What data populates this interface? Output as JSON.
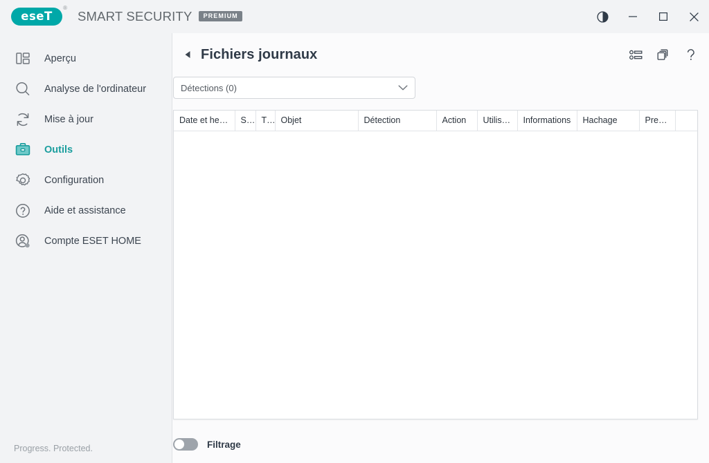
{
  "window": {
    "brand_logo_text": "eseT",
    "brand_registered_mark": "®",
    "brand_name": "SMART SECURITY",
    "brand_edition": "PREMIUM",
    "controls": [
      {
        "name": "theme-toggle-button",
        "icon": "contrast-icon",
        "label": ""
      },
      {
        "name": "minimize-button",
        "icon": "minimize-icon",
        "label": ""
      },
      {
        "name": "maximize-button",
        "icon": "maximize-icon",
        "label": ""
      },
      {
        "name": "close-button",
        "icon": "close-icon",
        "label": ""
      }
    ]
  },
  "sidebar": {
    "items": [
      {
        "label": "Aperçu",
        "icon": "dashboard-icon",
        "active": false
      },
      {
        "label": "Analyse de l'ordinateur",
        "icon": "magnifier-icon",
        "active": false
      },
      {
        "label": "Mise à jour",
        "icon": "refresh-icon",
        "active": false
      },
      {
        "label": "Outils",
        "icon": "toolbox-icon",
        "active": true
      },
      {
        "label": "Configuration",
        "icon": "gear-icon",
        "active": false
      },
      {
        "label": "Aide et assistance",
        "icon": "question-circle-icon",
        "active": false
      },
      {
        "label": "Compte ESET HOME",
        "icon": "user-account-icon",
        "active": false
      }
    ],
    "status_text": "Progress. Protected."
  },
  "main": {
    "back_label": "◀",
    "title": "Fichiers journaux",
    "header_tools": [
      {
        "name": "columns-settings-icon",
        "label": ""
      },
      {
        "name": "copy-window-icon",
        "label": ""
      },
      {
        "name": "help-icon",
        "label": "?"
      }
    ],
    "log_selector": {
      "value": "Détections (0)",
      "options": [
        "Détections (0)"
      ]
    },
    "table": {
      "columns": [
        "Date et heu…",
        "S…",
        "T…",
        "Objet",
        "Détection",
        "Action",
        "Utilisat…",
        "Informations",
        "Hachage",
        "Pre…",
        ""
      ],
      "rows": []
    },
    "filter": {
      "label": "Filtrage",
      "enabled": false
    }
  },
  "colors": {
    "accent_teal": "#1b9e9e",
    "logo_teal": "#00a8a8",
    "sidebar_bg": "#f2f3f5",
    "main_bg": "#fbfbfc",
    "text_dark": "#2f3a47",
    "text_muted": "#9aa0a6",
    "badge_gray": "#7a8188"
  }
}
